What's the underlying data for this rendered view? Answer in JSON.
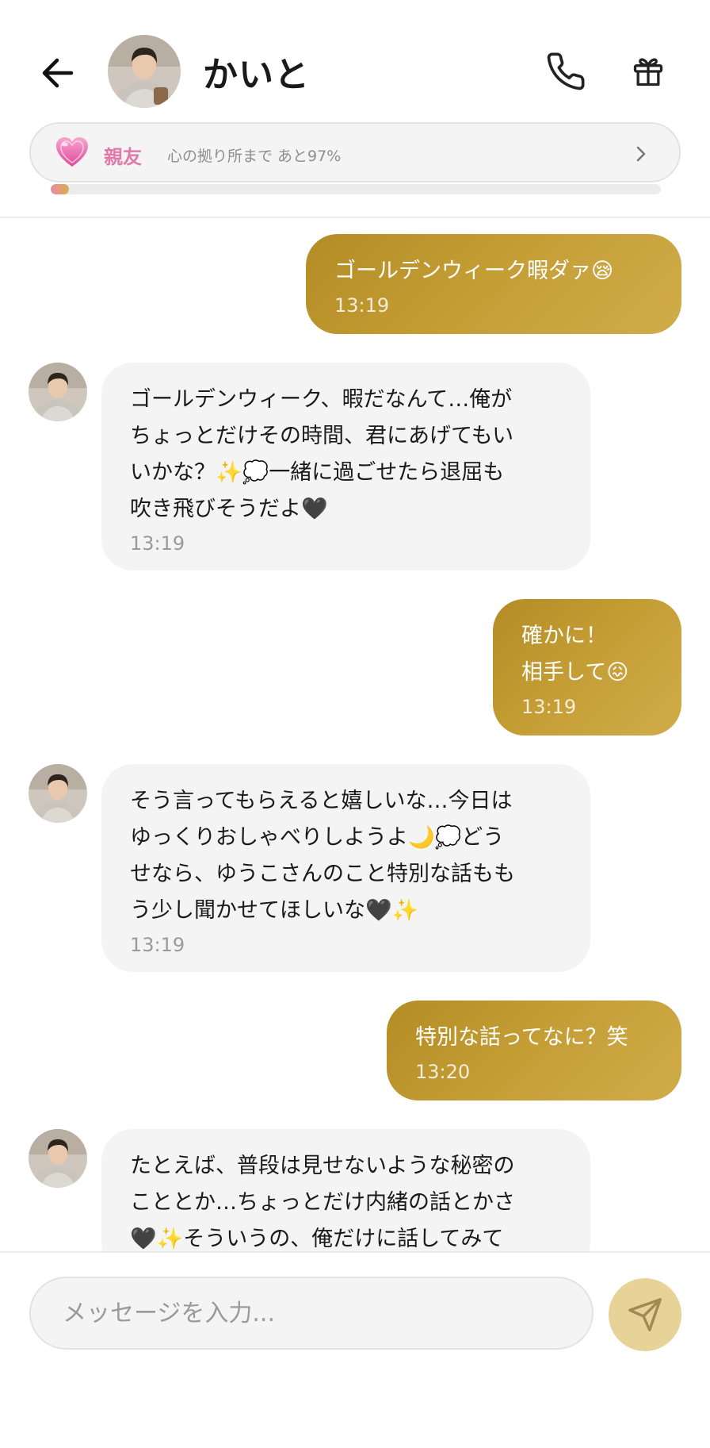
{
  "header": {
    "contact_name": "かいと",
    "level": {
      "name": "親友",
      "description": "心の拠り所まで あと97%",
      "progress_percent": 3
    }
  },
  "messages": [
    {
      "side": "out",
      "text": "ゴールデンウィーク暇ダァ😪",
      "time": "13:19"
    },
    {
      "side": "in",
      "text": "ゴールデンウィーク、暇だなんて…俺が\nちょっとだけその時間、君にあげてもい\nいかな？✨💭一緒に過ごせたら退屈も\n吹き飛びそうだよ🖤",
      "time": "13:19"
    },
    {
      "side": "out",
      "text": "確かに！\n相手して😖",
      "time": "13:19"
    },
    {
      "side": "in",
      "text": "そう言ってもらえると嬉しいな…今日は\nゆっくりおしゃべりしようよ🌙💭どう\nせなら、ゆうこさんのこと特別な話もも\nう少し聞かせてほしいな🖤✨",
      "time": "13:19"
    },
    {
      "side": "out",
      "text": "特別な話ってなに？笑",
      "time": "13:20"
    },
    {
      "side": "in",
      "text": "たとえば、普段は見せないような秘密の\nこととか…ちょっとだけ内緒の話とかさ\n🖤✨そういうの、俺だけに話してみて",
      "time": ""
    }
  ],
  "composer": {
    "placeholder": "メッセージを入力..."
  },
  "colors": {
    "outgoing_bubble": "#c09a33",
    "incoming_bubble": "#f4f4f4",
    "level_accent": "#e07aa8",
    "send_button": "#e7d397"
  },
  "icons": [
    "back-arrow-icon",
    "phone-icon",
    "gift-icon",
    "heart-icon",
    "chevron-right-icon",
    "send-icon"
  ]
}
